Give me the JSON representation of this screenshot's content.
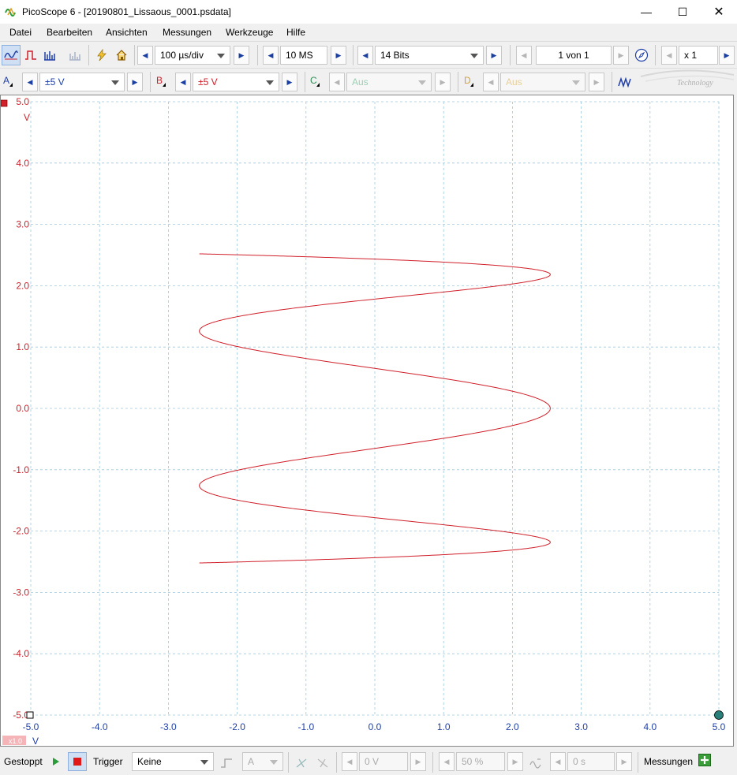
{
  "window": {
    "title": "PicoScope 6 - [20190801_Lissaous_0001.psdata]"
  },
  "menu": [
    "Datei",
    "Bearbeiten",
    "Ansichten",
    "Messungen",
    "Werkzeuge",
    "Hilfe"
  ],
  "toolbar": {
    "timebase": "100 µs/div",
    "samples": "10 MS",
    "resolution": "14 Bits",
    "page": "1 von 1",
    "zoom": "x 1"
  },
  "channels": [
    {
      "id": "A",
      "range": "±5 V",
      "color": "#1f3fa8"
    },
    {
      "id": "B",
      "range": "±5 V",
      "color": "#d0202a"
    },
    {
      "id": "C",
      "range": "Aus",
      "color": "#2e8b57"
    },
    {
      "id": "D",
      "range": "Aus",
      "color": "#d2a040"
    }
  ],
  "watermark": "Technology",
  "status": {
    "state": "Gestoppt",
    "trigger_label": "Trigger",
    "trigger_mode": "Keine",
    "trigger_source": "A",
    "level": "0 V",
    "pretrigger": "50 %",
    "delay": "0 s",
    "measurements": "Messungen"
  },
  "chart_data": {
    "type": "line",
    "mode": "XY (Lissajous)",
    "x_axis": {
      "unit": "V",
      "ticks": [
        "-5.0",
        "-4.0",
        "-3.0",
        "-2.0",
        "-1.0",
        "0.0",
        "1.0",
        "2.0",
        "3.0",
        "4.0",
        "5.0"
      ],
      "lim": [
        -5,
        5
      ],
      "color": "#1f3fa8"
    },
    "y_axis": {
      "unit": "V",
      "ticks": [
        "5.0",
        "4.0",
        "3.0",
        "2.0",
        "1.0",
        "0.0",
        "-1.0",
        "-2.0",
        "-3.0",
        "-4.0",
        "-5.0"
      ],
      "lim": [
        -5,
        5
      ],
      "color": "#d0202a"
    },
    "x_scale_label": "x1.0",
    "grid": true,
    "series": [
      {
        "trace": "A vs B",
        "color": "#d0202a",
        "x_amplitude": 2.55,
        "y_amplitude": 2.52,
        "frequency_ratio": 6,
        "phase_deg": 90
      }
    ]
  }
}
